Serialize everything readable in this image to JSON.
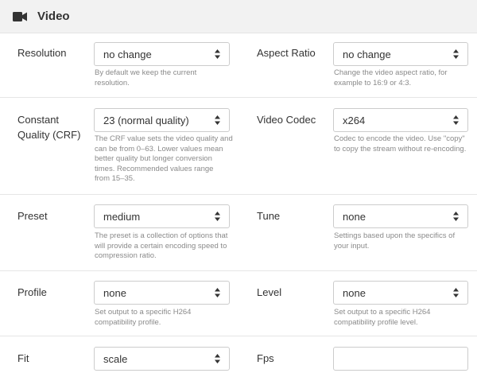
{
  "header": {
    "title": "Video",
    "icon": "video-camera-icon"
  },
  "fields": {
    "resolution": {
      "label": "Resolution",
      "value": "no change",
      "help": [
        "By default we keep the current",
        "resolution."
      ]
    },
    "aspect_ratio": {
      "label": "Aspect Ratio",
      "value": "no change",
      "help": [
        "Change the video aspect ratio, for",
        "example to 16:9 or 4:3."
      ]
    },
    "crf": {
      "label_lines": [
        "Constant",
        "Quality (CRF)"
      ],
      "value": "23 (normal quality)",
      "help": [
        "The CRF value sets the video quality and",
        "can be from 0–63. Lower values mean",
        "better quality but longer conversion",
        "times. Recommended values range",
        "from 15–35."
      ]
    },
    "video_codec": {
      "label": "Video Codec",
      "value": "x264",
      "help": [
        "Codec to encode the video. Use \"copy\"",
        "to copy the stream without re-encoding."
      ]
    },
    "preset": {
      "label": "Preset",
      "value": "medium",
      "help": [
        "The preset is a collection of options that",
        "will provide a certain encoding speed to",
        "compression ratio."
      ]
    },
    "tune": {
      "label": "Tune",
      "value": "none",
      "help": [
        "Settings based upon the specifics of",
        "your input."
      ]
    },
    "profile": {
      "label": "Profile",
      "value": "none",
      "help": [
        "Set output to a specific H264",
        "compatibility profile."
      ]
    },
    "level": {
      "label": "Level",
      "value": "none",
      "help": [
        "Set output to a specific H264",
        "compatibility profile level."
      ]
    },
    "fit": {
      "label": "Fit",
      "value": "scale"
    },
    "fps": {
      "label": "Fps",
      "value": ""
    }
  },
  "colors": {
    "header_bg": "#f2f2f2",
    "help_text": "#8a8a8a",
    "border": "#cccccc"
  }
}
